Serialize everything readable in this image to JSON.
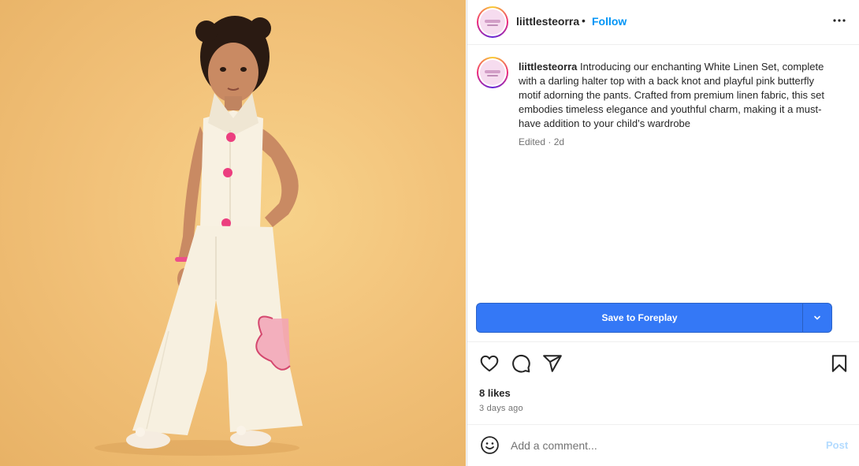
{
  "post": {
    "username": "liittlesteorra",
    "follow_label": "Follow",
    "separator": "•",
    "caption": "Introducing our enchanting White Linen Set, complete with a darling halter top with a back knot and playful pink butterfly motif adorning the pants. Crafted from premium linen fabric, this set embodies timeless elegance and youthful charm, making it a must-have addition to your child’s wardrobe",
    "meta": "Edited · 2d",
    "likes": "8 likes",
    "time_ago": "3 days ago"
  },
  "save": {
    "label": "Save to Foreplay"
  },
  "comment": {
    "placeholder": "Add a comment...",
    "post_label": "Post"
  },
  "colors": {
    "accent": "#0095f6",
    "save_button": "#3478f6",
    "post_disabled": "#b3dbff",
    "backdrop": "#f2c27a"
  },
  "icons": {
    "more": "more-options-icon",
    "like": "heart-icon",
    "comment": "comment-icon",
    "share": "share-icon",
    "bookmark": "bookmark-icon",
    "emoji": "emoji-icon",
    "dropdown": "chevron-down-icon"
  }
}
